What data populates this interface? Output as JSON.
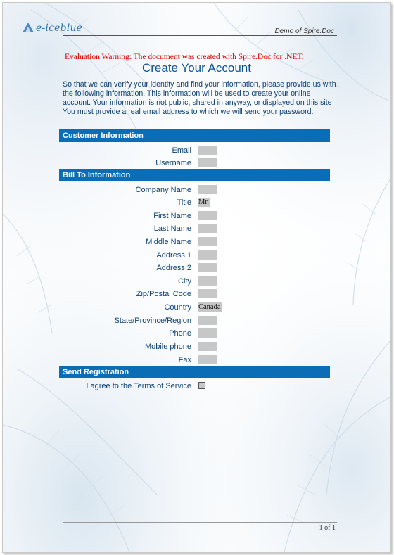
{
  "header": {
    "logo_text": "e-iceblue",
    "demo_text": "Demo of Spire.Doc"
  },
  "eval_warning": "Evaluation Warning: The document was created with Spire.Doc for .NET.",
  "title": "Create Your Account",
  "intro": {
    "paragraph": "So that we can verify your identity and find your information, please provide us with the following information. This information will be used to create your online account. Your information is not public, shared in anyway, or displayed on this site",
    "email_note": "You must provide a real email address to which we will send your password."
  },
  "sections": {
    "customer": {
      "title": "Customer Information",
      "fields": [
        {
          "label": "Email",
          "value": ""
        },
        {
          "label": "Username",
          "value": ""
        }
      ]
    },
    "billing": {
      "title": "Bill To Information",
      "fields": [
        {
          "label": "Company Name",
          "value": ""
        },
        {
          "label": "Title",
          "value": "Mr."
        },
        {
          "label": "First Name",
          "value": ""
        },
        {
          "label": "Last Name",
          "value": ""
        },
        {
          "label": "Middle Name",
          "value": ""
        },
        {
          "label": "Address 1",
          "value": ""
        },
        {
          "label": "Address 2",
          "value": ""
        },
        {
          "label": "City",
          "value": ""
        },
        {
          "label": "Zip/Postal Code",
          "value": ""
        },
        {
          "label": "Country",
          "value": "Canada"
        },
        {
          "label": "State/Province/Region",
          "value": ""
        },
        {
          "label": "Phone",
          "value": ""
        },
        {
          "label": "Mobile phone",
          "value": ""
        },
        {
          "label": "Fax",
          "value": ""
        }
      ]
    },
    "registration": {
      "title": "Send Registration",
      "agree_label": "I agree to the Terms of Service",
      "agree_checked": false
    }
  },
  "footer": {
    "page_indicator": "1 of 1"
  },
  "colors": {
    "section_bar": "#0b6db5",
    "title": "#0b5394",
    "label_text": "#0b3f74",
    "eval_warning": "#e00000",
    "field_fill": "#c7c7c7"
  }
}
